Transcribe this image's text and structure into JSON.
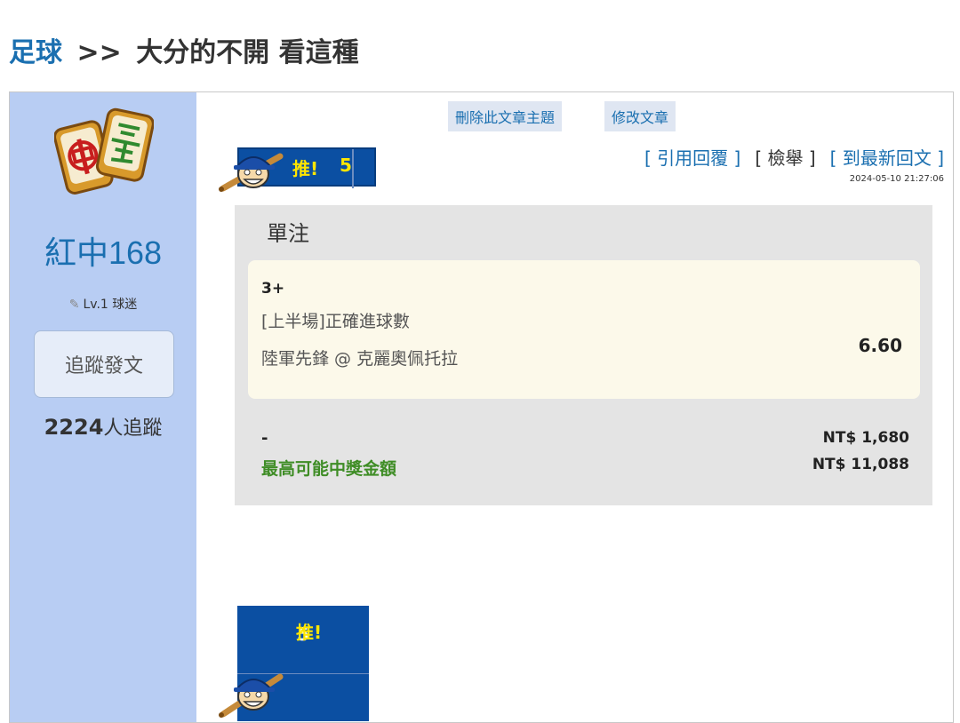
{
  "header": {
    "breadcrumb_link": "足球",
    "breadcrumb_sep": ">>",
    "topic_title": "大分的不開 看這種"
  },
  "user": {
    "avatar_icon": "mahjong-tiles-icon",
    "name": "紅中168",
    "level": "Lv.1 球迷",
    "follow_button": "追蹤發文",
    "follower_count": "2224",
    "follower_suffix": "人追蹤"
  },
  "admin": {
    "delete_label": "刪除此文章主題",
    "edit_label": "修改文章"
  },
  "push": {
    "label": "推!",
    "count": "5",
    "mascot_icon": "baseball-mascot-icon"
  },
  "actions": {
    "quote": "[ 引用回覆 ]",
    "report": "[ 檢舉 ]",
    "latest": "[ 到最新回文 ]",
    "timestamp": "2024-05-10 21:27:06"
  },
  "bet": {
    "type": "單注",
    "pick": "3+",
    "market": "[上半場]正確進球數",
    "match": "陸軍先鋒 @ 克麗奧佩托拉",
    "odds": "6.60",
    "stake_label": "-",
    "stake": "NT$ 1,680",
    "max_label": "最高可能中獎金額",
    "max_payout": "NT$ 11,088"
  },
  "bottom_push": {
    "count": "5",
    "label": "推!"
  },
  "colors": {
    "sidebar": "#b8cdf3",
    "link": "#1a6fb0",
    "push_blue": "#0b4fa2",
    "push_yellow": "#ffe600",
    "max_green": "#3f8d26",
    "bet_bg": "#e4e4e4",
    "bet_item_bg": "#fcf9ea"
  }
}
